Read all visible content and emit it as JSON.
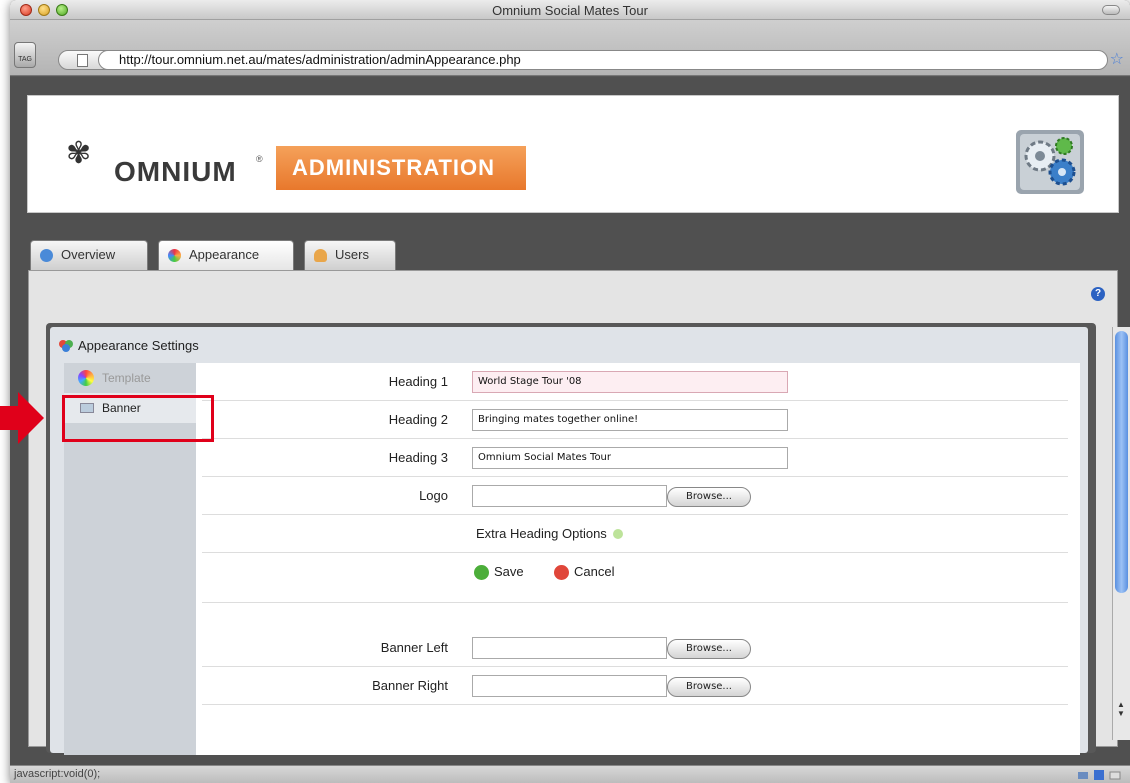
{
  "window": {
    "title": "Omnium Social Mates Tour",
    "url": "http://tour.omnium.net.au/mates/administration/adminAppearance.php",
    "tag_label": "TAG",
    "status": "javascript:void(0);"
  },
  "header": {
    "brand": "OMNIUM",
    "reg_mark": "®",
    "section": "ADMINISTRATION"
  },
  "tabs": [
    {
      "label": "Overview",
      "icon": "info-icon"
    },
    {
      "label": "Appearance",
      "icon": "palette-icon"
    },
    {
      "label": "Users",
      "icon": "user-icon"
    }
  ],
  "settings": {
    "title": "Appearance Settings",
    "side_nav": [
      {
        "label": "Template",
        "icon": "color-wheel-icon"
      },
      {
        "label": "Banner",
        "icon": "banner-icon"
      }
    ],
    "fields": {
      "heading1": {
        "label": "Heading 1",
        "value": "World Stage Tour '08"
      },
      "heading2": {
        "label": "Heading 2",
        "value": "Bringing mates together online!"
      },
      "heading3": {
        "label": "Heading 3",
        "value": "Omnium Social Mates Tour"
      },
      "logo": {
        "label": "Logo",
        "button": "Browse..."
      },
      "extra": {
        "label": "Extra Heading Options"
      },
      "save": "Save",
      "cancel": "Cancel",
      "banner_left": {
        "label": "Banner Left",
        "button": "Browse..."
      },
      "banner_right": {
        "label": "Banner Right",
        "button": "Browse..."
      }
    }
  },
  "colors": {
    "accent_orange": "#ec7f33",
    "highlight_red": "#e0001a",
    "scroll_blue": "#5a90e0"
  }
}
